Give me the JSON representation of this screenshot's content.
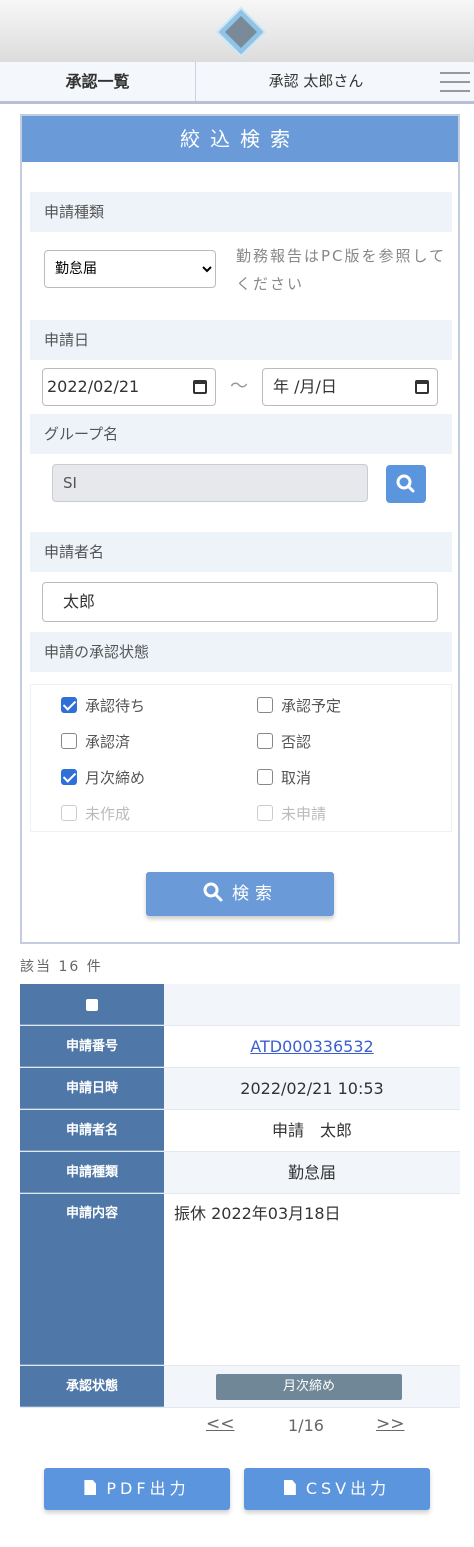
{
  "header": {
    "nav_title": "承認一覧",
    "user_label": "承認 太郎さん"
  },
  "search": {
    "title": "絞込検索",
    "type_label": "申請種類",
    "type_selected": "勤怠届",
    "type_note": "勤務報告はPC版を参照してください",
    "date_label": "申請日",
    "date_from": "2022/02/21",
    "date_to": "年 /月/日",
    "date_separator": "～",
    "group_label": "グループ名",
    "group_value": "SI",
    "applicant_label": "申請者名",
    "applicant_value": "太郎",
    "status_label": "申請の承認状態",
    "statuses": [
      {
        "label": "承認待ち",
        "checked": true,
        "enabled": true
      },
      {
        "label": "承認予定",
        "checked": false,
        "enabled": true
      },
      {
        "label": "承認済",
        "checked": false,
        "enabled": true
      },
      {
        "label": "否認",
        "checked": false,
        "enabled": true
      },
      {
        "label": "月次締め",
        "checked": true,
        "enabled": true
      },
      {
        "label": "取消",
        "checked": false,
        "enabled": true
      },
      {
        "label": "未作成",
        "checked": false,
        "enabled": false
      },
      {
        "label": "未申請",
        "checked": false,
        "enabled": false
      }
    ],
    "search_button": "検索"
  },
  "results": {
    "count_text": "該当 16 件",
    "rows": {
      "number_label": "申請番号",
      "number_value": "ATD000336532",
      "datetime_label": "申請日時",
      "datetime_value": "2022/02/21 10:53",
      "name_label": "申請者名",
      "name_value": "申請　太郎",
      "kind_label": "申請種類",
      "kind_value": "勤怠届",
      "content_label": "申請内容",
      "content_value": "振休 2022年03月18日",
      "status_label": "承認状態",
      "status_value": "月次締め"
    }
  },
  "pager": {
    "prev": "<<",
    "page": "1/16",
    "next": ">>"
  },
  "buttons": {
    "pdf": "PDF出力",
    "csv": "CSV出力"
  },
  "colors": {
    "accent": "#6a9bd8",
    "table_header": "#4f78a8",
    "status_badge": "#6f8796"
  }
}
